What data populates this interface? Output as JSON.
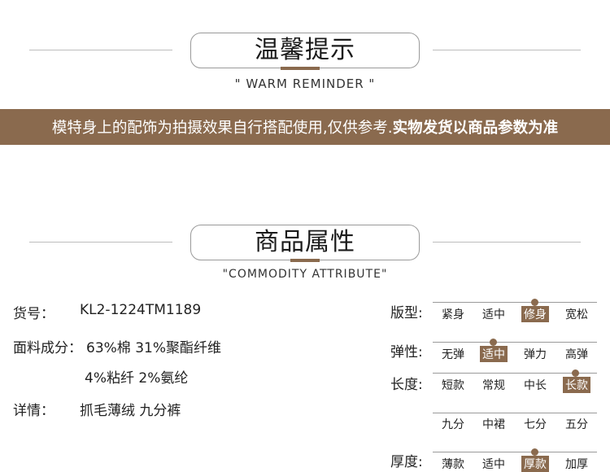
{
  "reminder": {
    "title": "温馨提示",
    "subtitle": "\" WARM REMINDER \""
  },
  "banner": {
    "normal": "模特身上的配饰为拍摄效果自行搭配使用,仅供参考.",
    "bold": "实物发货以商品参数为准"
  },
  "attribute": {
    "title": "商品属性",
    "subtitle": "\"COMMODITY ATTRIBUTE\""
  },
  "details": {
    "item_no_label": "货号：",
    "item_no_value": "KL2-1224TM1189",
    "fabric_label": "面料成分：",
    "fabric_line1": "63%棉 31%聚酯纤维",
    "fabric_line2": "4%粘纤 2%氨纶",
    "detail_label": "详情：",
    "detail_value": "抓毛薄绒 九分裤"
  },
  "attributes": {
    "fit": {
      "label": "版型:",
      "options": [
        "紧身",
        "适中",
        "修身",
        "宽松"
      ],
      "selected": 2
    },
    "elasticity": {
      "label": "弹性:",
      "options": [
        "无弹",
        "适中",
        "弹力",
        "高弹"
      ],
      "selected": 1
    },
    "length": {
      "label": "长度:",
      "options": [
        "短款",
        "常规",
        "中长",
        "长款"
      ],
      "selected": 3,
      "options2": [
        "九分",
        "中裙",
        "七分",
        "五分"
      ]
    },
    "thickness": {
      "label": "厚度:",
      "options": [
        "薄款",
        "适中",
        "厚款",
        "加厚"
      ],
      "selected": 2
    }
  },
  "colors": {
    "accent": "#8a6a4e"
  }
}
